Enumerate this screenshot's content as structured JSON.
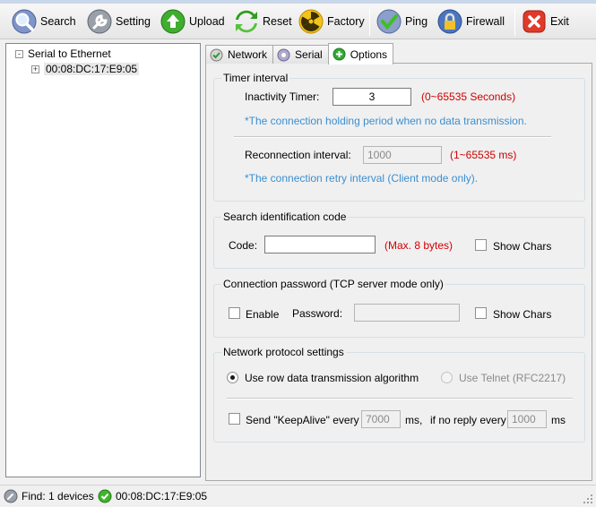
{
  "colors": {
    "accent_red": "#d00000",
    "hint_blue": "#3c8fd0",
    "disabled_gray": "#8a8a8a"
  },
  "toolbar": {
    "search": {
      "label": "Search",
      "icon": "magnifier-icon"
    },
    "setting": {
      "label": "Setting",
      "icon": "wrench-icon"
    },
    "upload": {
      "label": "Upload",
      "icon": "upload-arrow-icon"
    },
    "reset": {
      "label": "Reset",
      "icon": "recycle-icon"
    },
    "factory": {
      "label": "Factory",
      "icon": "radiation-icon"
    },
    "ping": {
      "label": "Ping",
      "icon": "check-circle-icon"
    },
    "firewall": {
      "label": "Firewall",
      "icon": "lock-shield-icon"
    },
    "exit": {
      "label": "Exit",
      "icon": "close-x-icon"
    }
  },
  "tree": {
    "root": {
      "label": "Serial to Ethernet",
      "expander": "-"
    },
    "child": {
      "label": "00:08:DC:17:E9:05",
      "expander": "+"
    }
  },
  "tabs": [
    {
      "label": "Network",
      "icon": "network-check-icon",
      "active": false
    },
    {
      "label": "Serial",
      "icon": "serial-disc-icon",
      "active": false
    },
    {
      "label": "Options",
      "icon": "options-plus-icon",
      "active": true
    }
  ],
  "timer": {
    "title": "Timer interval",
    "inactivity_label": "Inactivity Timer:",
    "inactivity_value": "3",
    "inactivity_range": "(0~65535 Seconds)",
    "inactivity_hint": "*The connection holding period when no data transmission.",
    "reconnect_label": "Reconnection interval:",
    "reconnect_value": "1000",
    "reconnect_range": "(1~65535 ms)",
    "reconnect_hint": "*The connection retry interval (Client mode only)."
  },
  "search_code": {
    "title": "Search identification code",
    "code_label": "Code:",
    "code_value": "",
    "max_hint": "(Max. 8 bytes)",
    "show_chars": "Show Chars",
    "show_chars_checked": false
  },
  "password": {
    "title": "Connection password (TCP server mode only)",
    "enable_label": "Enable",
    "enable_checked": false,
    "password_label": "Password:",
    "password_value": "",
    "show_chars": "Show Chars",
    "show_chars_checked": false
  },
  "protocol": {
    "title": "Network protocol settings",
    "row_data_label": "Use row data transmission algorithm",
    "row_data_selected": true,
    "telnet_label": "Use Telnet (RFC2217)",
    "telnet_selected": false,
    "keepalive_label": "Send \"KeepAlive\" every",
    "keepalive_checked": false,
    "keepalive_value": "7000",
    "keepalive_unit": "ms,",
    "noreply_label": "if no reply every",
    "noreply_value": "1000",
    "noreply_unit": "ms"
  },
  "status": {
    "find_text": "Find: 1 devices",
    "device_text": "00:08:DC:17:E9:05"
  }
}
